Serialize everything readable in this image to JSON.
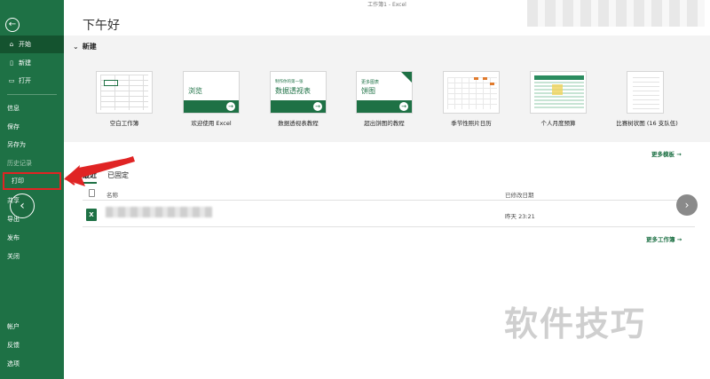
{
  "titlebar": {
    "title": "工作簿1  -  Excel"
  },
  "greeting": "下午好",
  "sidebar": {
    "items": [
      {
        "label": "开始",
        "icon": "home-icon",
        "glyph": "⌂"
      },
      {
        "label": "新建",
        "icon": "new-file-icon",
        "glyph": "▯"
      },
      {
        "label": "打开",
        "icon": "folder-icon",
        "glyph": "▭"
      },
      {
        "label": "信息"
      },
      {
        "label": "保存"
      },
      {
        "label": "另存为"
      },
      {
        "label": "历史记录"
      },
      {
        "label": "打印"
      },
      {
        "label": "共享"
      },
      {
        "label": "导出"
      },
      {
        "label": "发布"
      },
      {
        "label": "关闭"
      },
      {
        "label": "帐户"
      },
      {
        "label": "反馈"
      },
      {
        "label": "选项"
      }
    ]
  },
  "new_section": {
    "title": "新建",
    "templates": [
      {
        "label": "空白工作簿"
      },
      {
        "label": "欢迎使用 Excel",
        "thumb_text": "浏览"
      },
      {
        "label": "数据透视表教程",
        "thumb_small": "制作你的第一张",
        "thumb_text": "数据透视表"
      },
      {
        "label": "超出饼图的教程",
        "thumb_small": "更多图表",
        "thumb_text": "饼图"
      },
      {
        "label": "季节性照片日历"
      },
      {
        "label": "个人月度预算"
      },
      {
        "label": "比赛树状图 (16 支队伍)"
      }
    ],
    "more_label": "更多模板 →"
  },
  "tabs": [
    {
      "label": "最近"
    },
    {
      "label": "已固定"
    }
  ],
  "list": {
    "col_name": "名称",
    "col_modified": "已修改日期",
    "rows": [
      {
        "date": "昨天 23:21",
        "icon": "X"
      }
    ]
  },
  "more_workbooks": "更多工作簿 →",
  "watermark": "软件技巧",
  "colors": {
    "excel_green": "#1e7145",
    "highlight_red": "#e02424"
  }
}
